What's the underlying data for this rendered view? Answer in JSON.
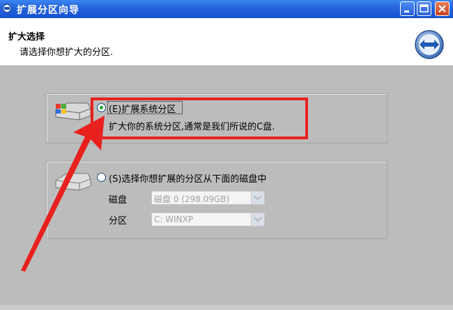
{
  "window": {
    "title": "扩展分区向导"
  },
  "header": {
    "title": "扩大选择",
    "subtitle": "请选择你想扩大的分区."
  },
  "option1": {
    "label": "(E)扩展系统分区",
    "description": "扩大你的系统分区,通常是我们所说的C盘.",
    "checked": true
  },
  "option2": {
    "label": "(S)选择你想扩展的分区从下面的磁盘中",
    "checked": false,
    "disk_label": "磁盘",
    "disk_value": "磁盘 0 (298.09GB)",
    "partition_label": "分区",
    "partition_value": "C: WINXP"
  },
  "colors": {
    "annotation": "#e8211e",
    "titlebar": "#2566dd"
  },
  "icons": [
    "wizard-icon",
    "system-drive-icon",
    "drive-icon",
    "minimize-icon",
    "maximize-icon",
    "close-icon"
  ]
}
